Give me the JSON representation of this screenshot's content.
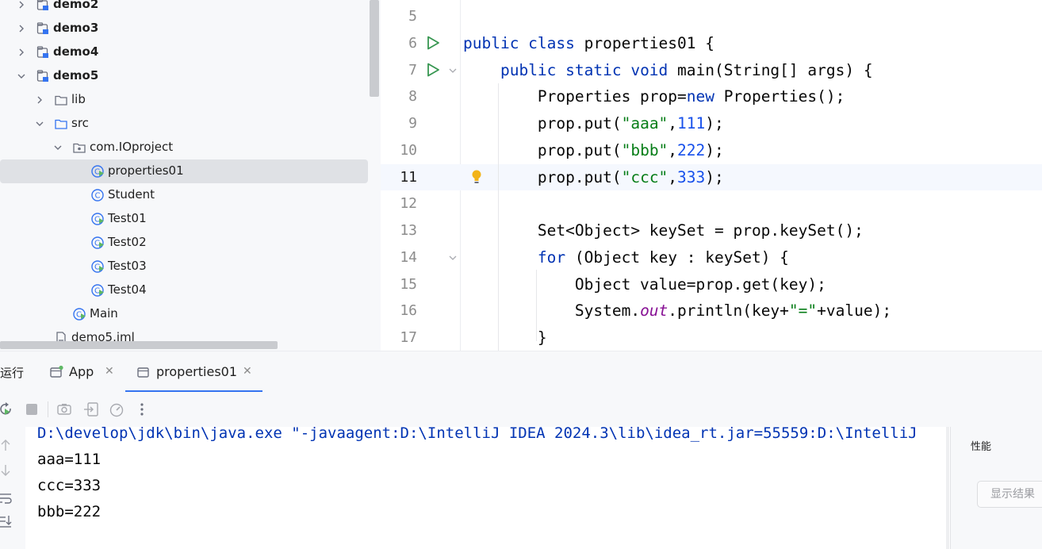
{
  "project_tree": {
    "items": [
      {
        "label": "demo2",
        "kind": "module",
        "expanded": false,
        "bold": true
      },
      {
        "label": "demo3",
        "kind": "module",
        "expanded": false,
        "bold": true
      },
      {
        "label": "demo4",
        "kind": "module",
        "expanded": false,
        "bold": true
      },
      {
        "label": "demo5",
        "kind": "module",
        "expanded": true,
        "bold": true
      },
      {
        "label": "lib",
        "kind": "folder",
        "expanded": false
      },
      {
        "label": "src",
        "kind": "source-folder",
        "expanded": true
      },
      {
        "label": "com.IOproject",
        "kind": "package",
        "expanded": true
      },
      {
        "label": "properties01",
        "kind": "runnable-class",
        "selected": true
      },
      {
        "label": "Student",
        "kind": "class"
      },
      {
        "label": "Test01",
        "kind": "runnable-class"
      },
      {
        "label": "Test02",
        "kind": "runnable-class"
      },
      {
        "label": "Test03",
        "kind": "runnable-class"
      },
      {
        "label": "Test04",
        "kind": "runnable-class"
      },
      {
        "label": "Main",
        "kind": "runnable-class"
      },
      {
        "label": "demo5.iml",
        "kind": "file"
      }
    ]
  },
  "editor": {
    "current_line": "11",
    "lines": [
      {
        "no": "5",
        "tokens": []
      },
      {
        "no": "6",
        "tokens": [
          [
            "kw",
            "public class "
          ],
          [
            "",
            "properties01 {"
          ]
        ],
        "run_icon": true
      },
      {
        "no": "7",
        "tokens": [
          [
            "",
            "    "
          ],
          [
            "kw",
            "public static void "
          ],
          [
            "",
            "main(String[] args) {"
          ]
        ],
        "run_icon": true,
        "fold": true
      },
      {
        "no": "8",
        "tokens": [
          [
            "",
            "        Properties prop="
          ],
          [
            "kw",
            "new "
          ],
          [
            "",
            "Properties();"
          ]
        ]
      },
      {
        "no": "9",
        "tokens": [
          [
            "",
            "        prop.put("
          ],
          [
            "str",
            "\"aaa\""
          ],
          [
            "",
            ","
          ],
          [
            "num",
            "111"
          ],
          [
            "",
            ");"
          ]
        ]
      },
      {
        "no": "10",
        "tokens": [
          [
            "",
            "        prop.put("
          ],
          [
            "str",
            "\"bbb\""
          ],
          [
            "",
            ","
          ],
          [
            "num",
            "222"
          ],
          [
            "",
            ");"
          ]
        ]
      },
      {
        "no": "11",
        "tokens": [
          [
            "",
            "        prop.put("
          ],
          [
            "str",
            "\"ccc\""
          ],
          [
            "",
            ","
          ],
          [
            "num",
            "333"
          ],
          [
            "",
            ");"
          ]
        ],
        "bulb": true
      },
      {
        "no": "12",
        "tokens": []
      },
      {
        "no": "13",
        "tokens": [
          [
            "",
            "        Set<Object> keySet = prop.keySet();"
          ]
        ]
      },
      {
        "no": "14",
        "tokens": [
          [
            "",
            "        "
          ],
          [
            "kw",
            "for "
          ],
          [
            "",
            "(Object key : keySet) {"
          ]
        ],
        "fold": true
      },
      {
        "no": "15",
        "tokens": [
          [
            "",
            "            Object value=prop.get(key);"
          ]
        ]
      },
      {
        "no": "16",
        "tokens": [
          [
            "",
            "            System."
          ],
          [
            "fld",
            "out"
          ],
          [
            "",
            ".println(key+"
          ],
          [
            "str",
            "\"=\""
          ],
          [
            "",
            "+value);"
          ]
        ]
      },
      {
        "no": "17",
        "tokens": [
          [
            "",
            "        }"
          ]
        ]
      }
    ]
  },
  "run_window": {
    "title": "运行",
    "tabs": [
      {
        "label": "App",
        "active": false
      },
      {
        "label": "properties01",
        "active": true
      }
    ],
    "toolbar": [
      "rerun-icon",
      "stop-icon",
      "camera-icon",
      "exit-icon",
      "gauge-icon",
      "more-icon"
    ],
    "console_lines": [
      {
        "text": "D:\\develop\\jdk\\bin\\java.exe \"-javaagent:D:\\IntelliJ IDEA 2024.3\\lib\\idea_rt.jar=55559:D:\\IntelliJ",
        "kind": "cmd"
      },
      {
        "text": "aaa=111",
        "kind": "plain"
      },
      {
        "text": "ccc=333",
        "kind": "plain"
      },
      {
        "text": "bbb=222",
        "kind": "plain"
      }
    ],
    "side_icons": [
      "arrow-up-icon",
      "arrow-down-icon",
      "soft-wrap-icon",
      "scroll-to-end-icon"
    ],
    "performance": {
      "label": "性能",
      "button": "显示结果"
    }
  },
  "colors": {
    "keyword": "#0033b3",
    "string": "#067d17",
    "number": "#1750eb",
    "field": "#871094",
    "accent": "#3574f0",
    "run_green": "#369650"
  }
}
